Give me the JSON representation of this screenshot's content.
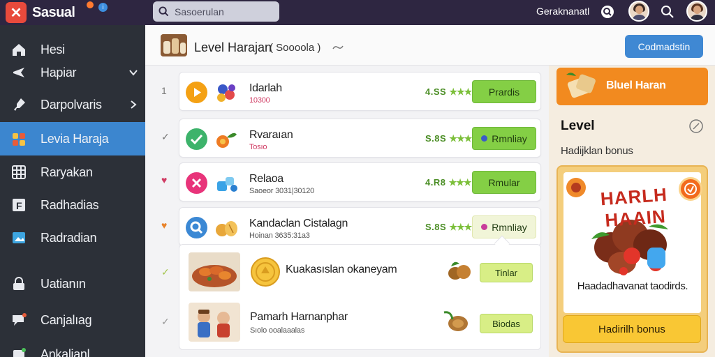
{
  "app": {
    "brand": "Sasual",
    "brand_mark": "✕",
    "search_placeholder": "Sasoerulan",
    "user_name": "Geraknanatl"
  },
  "sidebar": {
    "items": [
      {
        "label": "Hesi",
        "icon": "home-icon"
      },
      {
        "label": "Hapiar",
        "icon": "plane-icon",
        "has_chevron": true
      },
      {
        "label": "Darpolvaris",
        "icon": "pin-icon",
        "has_chevron": true
      },
      {
        "label": "Levia Haraja",
        "icon": "puzzle-icon",
        "active": true
      },
      {
        "label": "Raryakan",
        "icon": "grid-icon"
      },
      {
        "label": "Radhadias",
        "icon": "f-square-icon"
      },
      {
        "label": "Radradian",
        "icon": "image-icon"
      },
      {
        "label": "Uatianın",
        "icon": "lock-icon"
      },
      {
        "label": "Canjalıag",
        "icon": "chat-icon"
      },
      {
        "label": "Ankalianl",
        "icon": "box-icon"
      }
    ]
  },
  "header": {
    "title": "Level Harajan",
    "subtitle": "( Soooola )",
    "primary_button": "Codmadstin"
  },
  "list": {
    "rows": [
      {
        "mark": "1",
        "title": "Idarlah",
        "sub": "10300",
        "rating": "4.SS",
        "action": "Prardis",
        "circle": "#f4a114",
        "state": "play"
      },
      {
        "mark": "✓",
        "title": "Rvaraıan",
        "sub": "Tosıo",
        "rating": "S.8S",
        "action": "Rmnliay",
        "circle": "#3db36b",
        "state": "check"
      },
      {
        "mark": "♥",
        "title": "Relaoa",
        "sub": "Saoeor 3031|30120",
        "rating": "4.R8",
        "action": "Rmular",
        "circle": "#e8347a",
        "state": "close"
      },
      {
        "mark": "♥",
        "title": "Kandaclan Cistalagn",
        "sub": "Hoinan 3635:31a3",
        "rating": "S.8S",
        "action": "Rmnliay",
        "circle": "#3b88d4",
        "state": "search"
      }
    ],
    "expanded": [
      {
        "mark": "✓",
        "title": "Kuakasıslan okaneyam",
        "action": "Tinlar"
      },
      {
        "mark": "✓",
        "title": "Pamarh Harnanphar",
        "sub": "Sıolo ooalaaalas",
        "action": "Biodas"
      }
    ]
  },
  "right_panel": {
    "banner": "Bluel Haran",
    "heading": "Level",
    "subheading": "Hadijklan bonus",
    "promo_title": "HARLH HAAIN",
    "promo_caption": "Haadadhavanat taodirds.",
    "promo_button": "Hadirilh bonus"
  },
  "colors": {
    "topbar": "#2e2641",
    "sidebar": "#2c3038",
    "accent": "#3c86cf",
    "action_green": "#84cf45",
    "banner_orange": "#f28a1f",
    "promo_yellow": "#f9c734"
  }
}
